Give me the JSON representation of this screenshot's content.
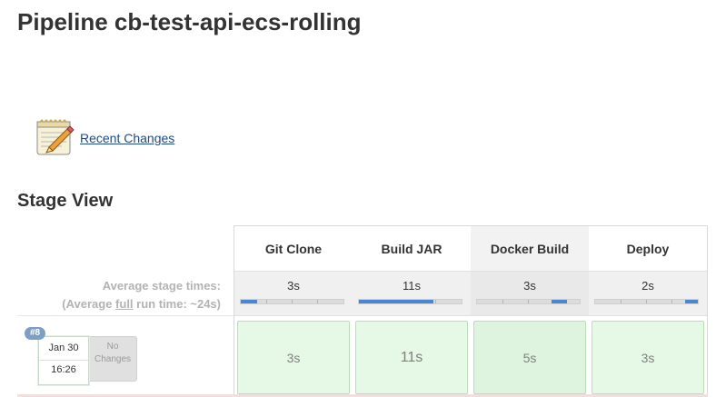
{
  "page": {
    "title": "Pipeline cb-test-api-ecs-rolling"
  },
  "recent_changes": {
    "icon": "notepad-pencil-icon",
    "link_label": "Recent Changes"
  },
  "stage_view": {
    "title": "Stage View",
    "avg_label_line1": "Average stage times:",
    "avg_label_prefix": "(Average ",
    "avg_label_full": "full",
    "avg_label_suffix": " run time: ~24s)",
    "stages": [
      {
        "name": "Git Clone",
        "avg_time": "3s",
        "progress_start": 0.0,
        "progress_end": 0.16
      },
      {
        "name": "Build JAR",
        "avg_time": "11s",
        "progress_start": 0.0,
        "progress_end": 0.73
      },
      {
        "name": "Docker Build",
        "avg_time": "3s",
        "progress_start": 0.73,
        "progress_end": 0.88
      },
      {
        "name": "Deploy",
        "avg_time": "2s",
        "progress_start": 0.88,
        "progress_end": 1.0
      }
    ],
    "build": {
      "number": "#8",
      "date": "Jan 30",
      "time": "16:26",
      "changes_line1": "No",
      "changes_line2": "Changes",
      "stage_times": [
        "3s",
        "11s",
        "5s",
        "3s"
      ]
    },
    "colors": {
      "success_bg": "#e6f9e6",
      "progress": "#4a86d4",
      "badge": "#7d9fc6"
    }
  }
}
